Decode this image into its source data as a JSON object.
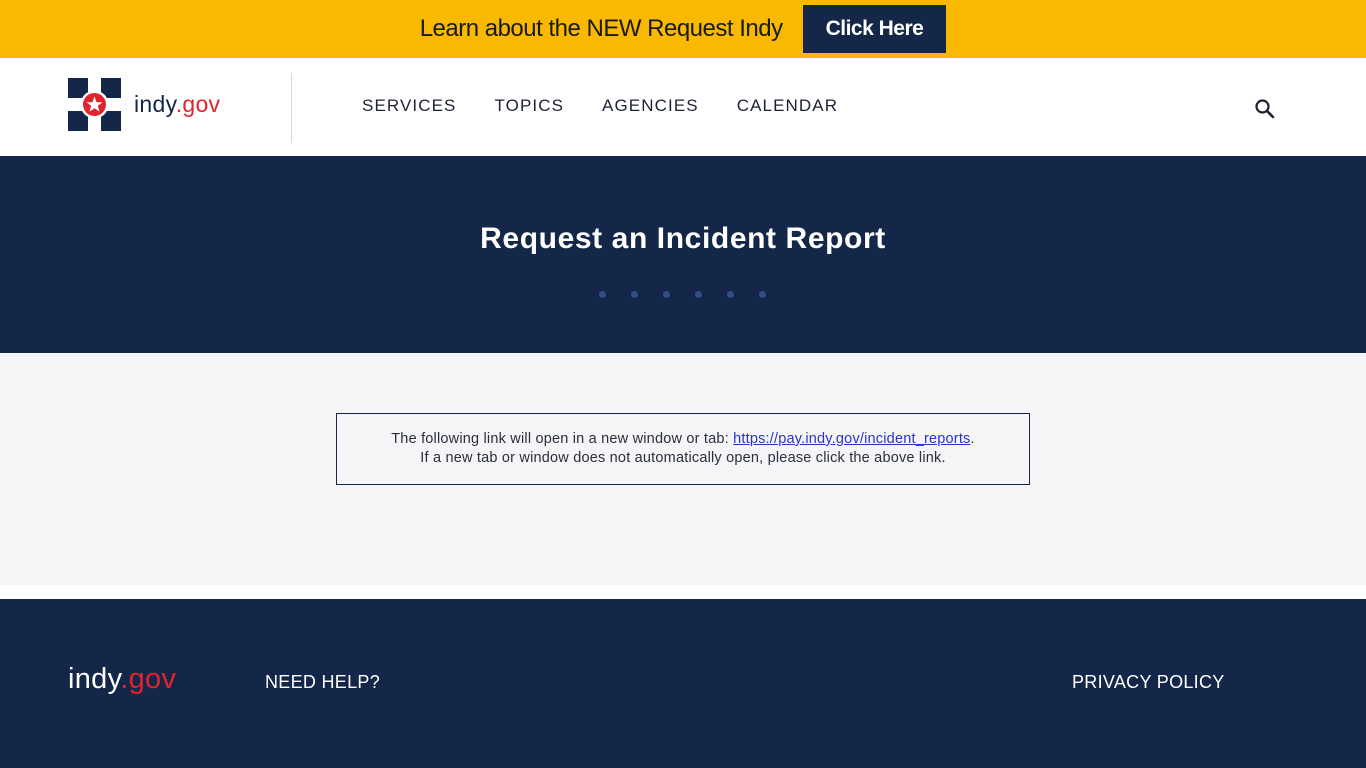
{
  "banner": {
    "text": "Learn about the NEW Request Indy",
    "button_label": "Click Here"
  },
  "header": {
    "logo": {
      "word": "indy",
      "suffix": ".gov"
    },
    "nav": [
      {
        "label": "SERVICES"
      },
      {
        "label": "TOPICS"
      },
      {
        "label": "AGENCIES"
      },
      {
        "label": "CALENDAR"
      }
    ],
    "search_icon": "search-icon"
  },
  "hero": {
    "title": "Request an Incident Report"
  },
  "notice": {
    "line1_prefix": "The following link will open in a new window or tab: ",
    "link_text": "https://pay.indy.gov/incident_reports",
    "line1_suffix": ".",
    "line2": "If a new tab or window does not automatically open, please click the above link."
  },
  "footer": {
    "logo": {
      "word": "indy",
      "suffix": ".gov"
    },
    "help_label": "NEED HELP?",
    "privacy_label": "PRIVACY POLICY"
  },
  "colors": {
    "banner_bg": "#f8b900",
    "navy": "#152748",
    "accent_red": "#e0232d",
    "link": "#2a35c8"
  }
}
